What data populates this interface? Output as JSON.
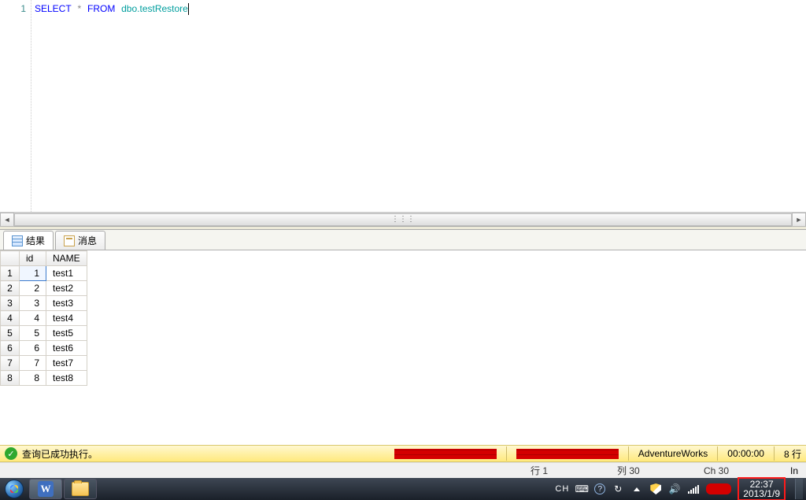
{
  "editor": {
    "line_number": "1",
    "sql_kw_select": "SELECT",
    "sql_star": "*",
    "sql_kw_from": "FROM",
    "sql_ident": "dbo.testRestore"
  },
  "tabs": {
    "results": "结果",
    "messages": "消息"
  },
  "results": {
    "columns": [
      "",
      "id",
      "NAME"
    ],
    "rows": [
      {
        "n": "1",
        "id": "1",
        "name": "test1"
      },
      {
        "n": "2",
        "id": "2",
        "name": "test2"
      },
      {
        "n": "3",
        "id": "3",
        "name": "test3"
      },
      {
        "n": "4",
        "id": "4",
        "name": "test4"
      },
      {
        "n": "5",
        "id": "5",
        "name": "test5"
      },
      {
        "n": "6",
        "id": "6",
        "name": "test6"
      },
      {
        "n": "7",
        "id": "7",
        "name": "test7"
      },
      {
        "n": "8",
        "id": "8",
        "name": "test8"
      }
    ]
  },
  "status_yellow": {
    "success": "查询已成功执行。",
    "database": "AdventureWorks",
    "elapsed": "00:00:00",
    "rowcount": "8 行"
  },
  "status_gray": {
    "line": "行 1",
    "col": "列 30",
    "ch": "Ch 30",
    "ins": "In"
  },
  "taskbar": {
    "word_glyph": "W",
    "ime": "CH",
    "kb_glyph": "⌨",
    "help_glyph": "?",
    "sync_glyph": "↻",
    "vol_glyph": "🔊",
    "clock_time": "22:37",
    "clock_date": "2013/1/9"
  }
}
